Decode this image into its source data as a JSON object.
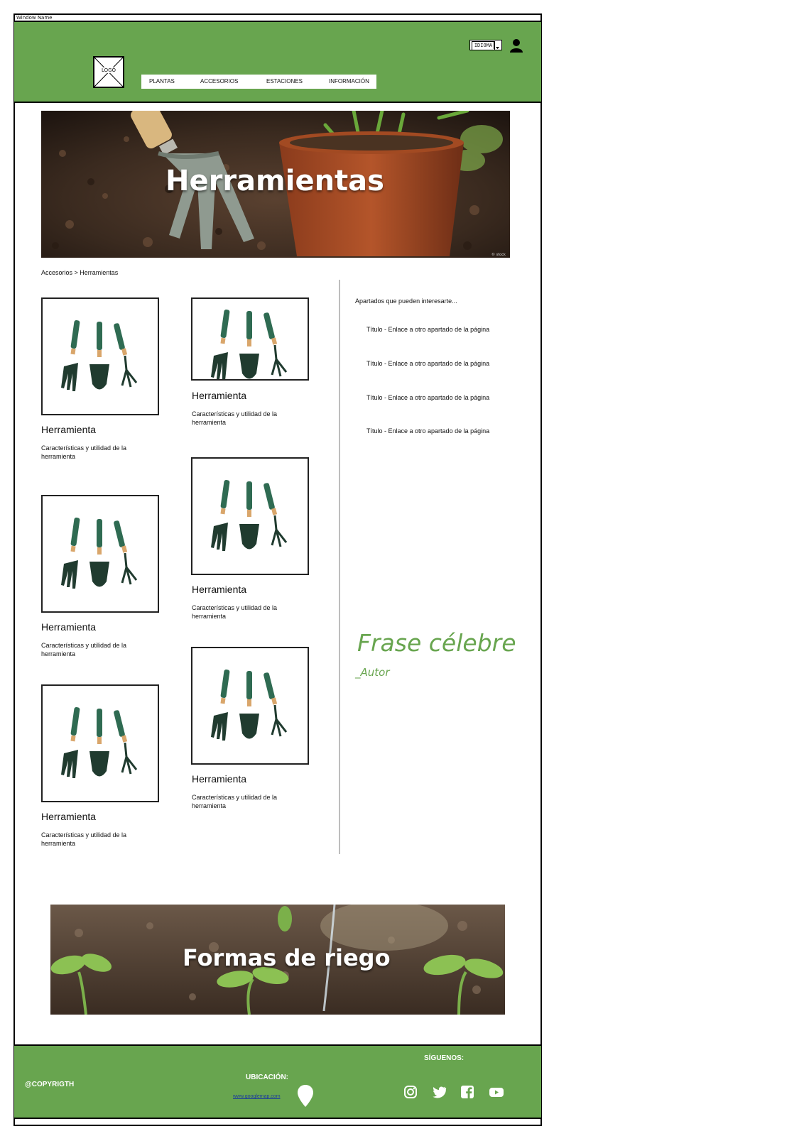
{
  "window": {
    "title": "Window Name"
  },
  "header": {
    "logo_text": "LOGO",
    "nav": [
      "PLANTAS",
      "ACCESORIOS",
      "ESTACIONES",
      "INFORMACIÓN"
    ],
    "language_label": "IDIOMA",
    "icons": {
      "user": "user-icon",
      "dropdown": "chevron-down-icon"
    }
  },
  "hero": {
    "title": "Herramientas"
  },
  "breadcrumb": "Accesorios > Herramientas",
  "products": [
    {
      "title": "Herramienta",
      "description": "Características y utilidad de la herramienta"
    },
    {
      "title": "Herramienta",
      "description": "Características y utilidad de la herramienta"
    },
    {
      "title": "Herramienta",
      "description": "Características y utilidad de la herramienta"
    },
    {
      "title": "Herramienta",
      "description": "Características y utilidad de la herramienta"
    },
    {
      "title": "Herramienta",
      "description": "Características y utilidad de la herramienta"
    },
    {
      "title": "Herramienta",
      "description": "Características y utilidad de la herramienta"
    }
  ],
  "sidebar": {
    "heading": "Apartados que pueden interesarte...",
    "links": [
      "Título - Enlace a otro apartado de la página",
      "Título - Enlace a otro apartado de la página",
      "Título - Enlace a otro apartado de la página",
      "Título - Enlace a otro apartado de la página"
    ],
    "quote": "Frase célebre",
    "author": "_Autor"
  },
  "banner": {
    "title": "Formas de riego"
  },
  "footer": {
    "copyright": "@COPYRIGTH",
    "location_label": "UBICACIÓN:",
    "map_link": "www.googlemap.com",
    "follow_label": "SÍGUENOS:",
    "social": [
      "instagram-icon",
      "twitter-icon",
      "facebook-icon",
      "youtube-icon"
    ]
  },
  "colors": {
    "brand_green": "#68a54f",
    "link_blue": "#1a3a9c"
  }
}
